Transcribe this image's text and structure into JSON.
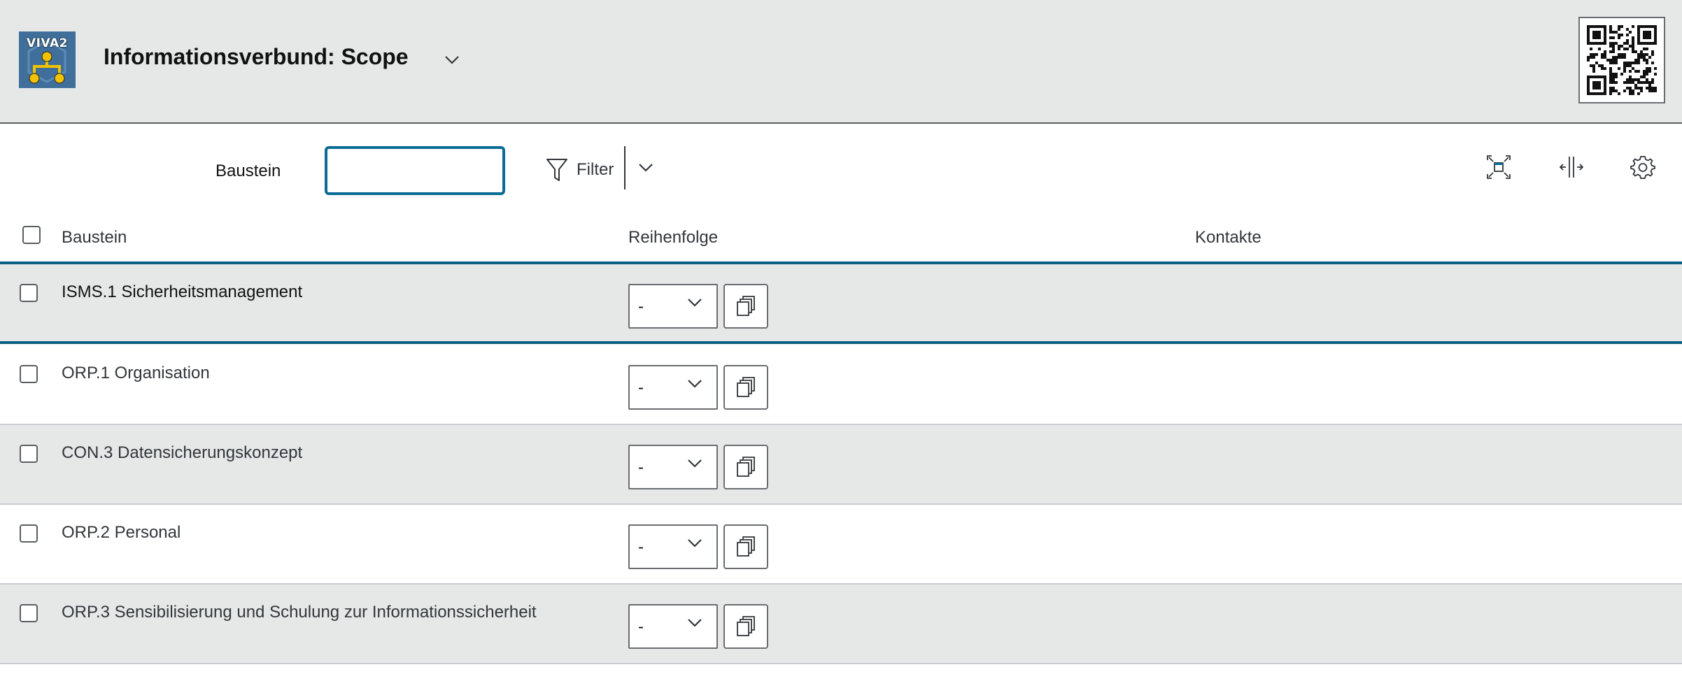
{
  "header": {
    "logo_text": "VIVA2",
    "title": "Informationsverbund: Scope",
    "title_menu_icon": "chevron-down-icon",
    "qr_icon": "qr-code-icon"
  },
  "toolbar": {
    "search_label": "Baustein",
    "search_value": "",
    "filter_label": "Filter",
    "filter_icon": "filter-funnel-icon",
    "icons": [
      "fit-screen-icon",
      "column-resize-icon",
      "settings-gear-icon"
    ]
  },
  "table": {
    "columns": [
      "Baustein",
      "Reihenfolge",
      "Kontakte"
    ],
    "rows": [
      {
        "label": "ISMS.1 Sicherheitsmanagement",
        "order": "-",
        "contacts": "",
        "selected": true
      },
      {
        "label": "ORP.1 Organisation",
        "order": "-",
        "contacts": "",
        "selected": false
      },
      {
        "label": "CON.3 Datensicherungskonzept",
        "order": "-",
        "contacts": "",
        "selected": false
      },
      {
        "label": "ORP.2 Personal",
        "order": "-",
        "contacts": "",
        "selected": false
      },
      {
        "label": "ORP.3 Sensibilisierung und Schulung zur Informationssicherheit",
        "order": "-",
        "contacts": "",
        "selected": false
      }
    ]
  },
  "colors": {
    "header_bg": "#e6e8e8",
    "accent": "#0a5f82",
    "focus_border": "#0a6c94",
    "logo_bg": "#3f6f9a",
    "logo_accent": "#f2c200"
  }
}
